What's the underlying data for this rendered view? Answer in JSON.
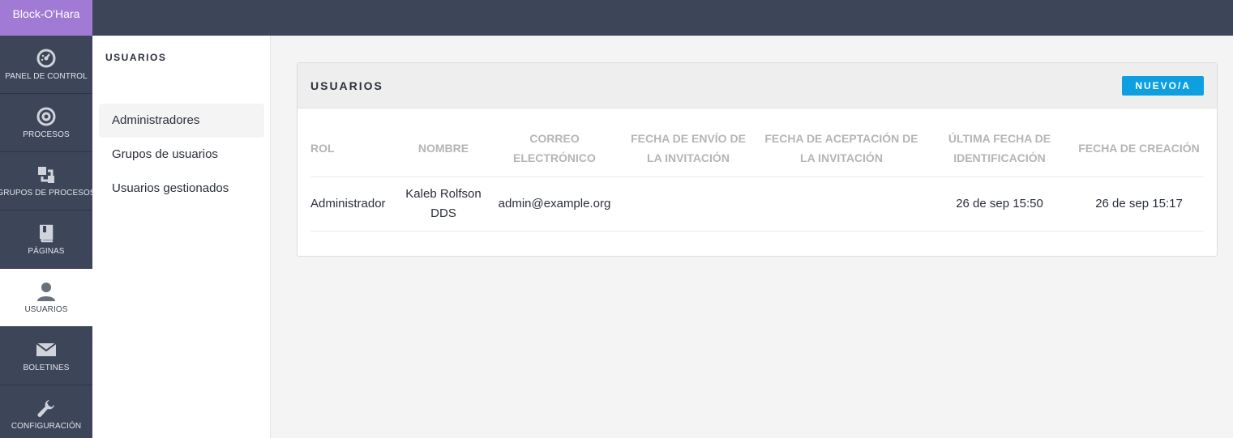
{
  "brand": "Block-O'Hara",
  "rail": [
    {
      "label": "PANEL DE CONTROL",
      "icon": "dashboard-icon"
    },
    {
      "label": "PROCESOS",
      "icon": "target-icon"
    },
    {
      "label": "GRUPOS DE PROCESOS",
      "icon": "stack-icon"
    },
    {
      "label": "PÁGINAS",
      "icon": "book-icon"
    },
    {
      "label": "USUARIOS",
      "icon": "user-icon",
      "active": true
    },
    {
      "label": "BOLETINES",
      "icon": "envelope-icon"
    },
    {
      "label": "CONFIGURACIÓN",
      "icon": "wrench-icon"
    }
  ],
  "subnav": {
    "title": "USUARIOS",
    "items": [
      {
        "label": "Administradores",
        "active": true
      },
      {
        "label": "Grupos de usuarios"
      },
      {
        "label": "Usuarios gestionados"
      }
    ]
  },
  "panel": {
    "title": "USUARIOS",
    "new_button": "NUEVO/A",
    "columns": [
      "ROL",
      "NOMBRE",
      "CORREO ELECTRÓNICO",
      "FECHA DE ENVÍO DE LA INVITACIÓN",
      "FECHA DE ACEPTACIÓN DE LA INVITACIÓN",
      "ÚLTIMA FECHA DE IDENTIFICACIÓN",
      "FECHA DE CREACIÓN"
    ],
    "rows": [
      [
        "Administrador",
        "Kaleb Rolfson DDS",
        "admin@example.org",
        "",
        "",
        "26 de sep 15:50",
        "26 de sep 15:17"
      ]
    ]
  },
  "colors": {
    "topbar": "#3d4559",
    "brand": "#a07ad4",
    "accent": "#0d9fe0"
  }
}
